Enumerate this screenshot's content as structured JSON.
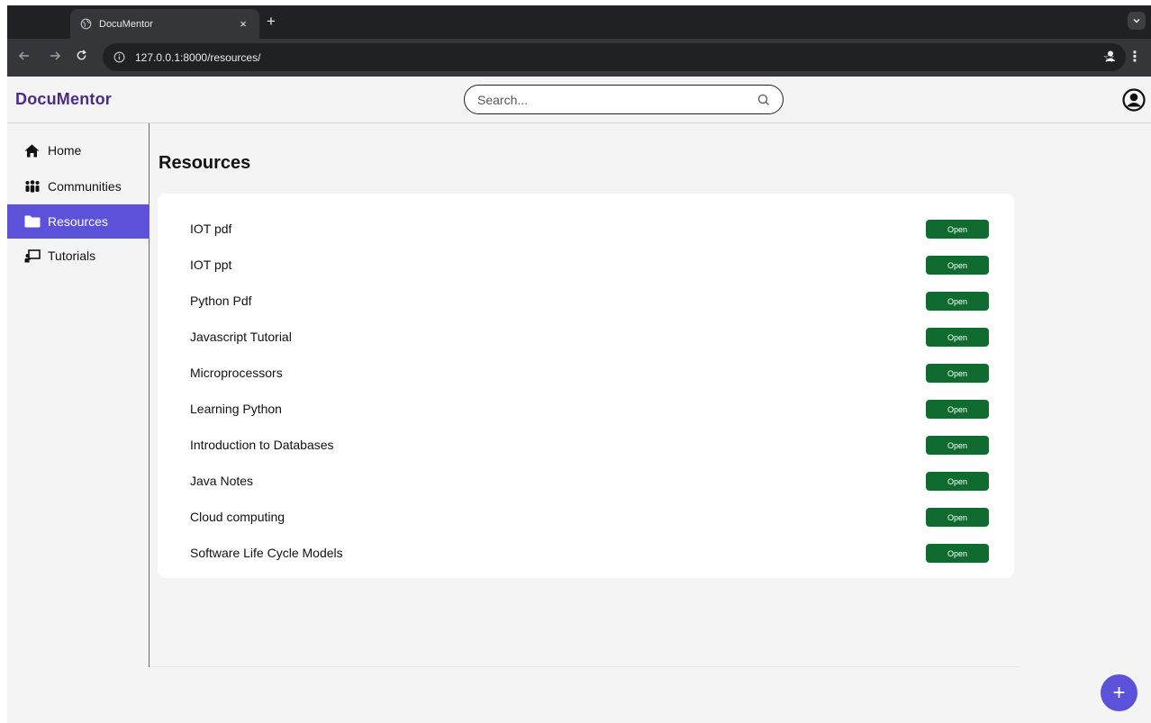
{
  "browser": {
    "tab_title": "DocuMentor",
    "tab_close": "×",
    "new_tab": "+",
    "url": "127.0.0.1:8000/resources/"
  },
  "app": {
    "brand": "DocuMentor",
    "search_placeholder": "Search...",
    "accent_color": "#5c52d9",
    "open_button_color": "#0f6b30"
  },
  "sidebar": {
    "items": [
      {
        "label": "Home",
        "icon": "home-icon",
        "active": false
      },
      {
        "label": "Communities",
        "icon": "users-icon",
        "active": false
      },
      {
        "label": "Resources",
        "icon": "folder-icon",
        "active": true
      },
      {
        "label": "Tutorials",
        "icon": "presentation-icon",
        "active": false
      }
    ]
  },
  "main": {
    "title": "Resources",
    "open_label": "Open",
    "resources": [
      "IOT pdf",
      "IOT ppt",
      "Python Pdf",
      "Javascript Tutorial",
      "Microprocessors",
      "Learning Python",
      "Introduction to Databases",
      "Java Notes",
      "Cloud computing",
      "Software Life Cycle Models"
    ]
  },
  "fab": {
    "label": "+"
  }
}
